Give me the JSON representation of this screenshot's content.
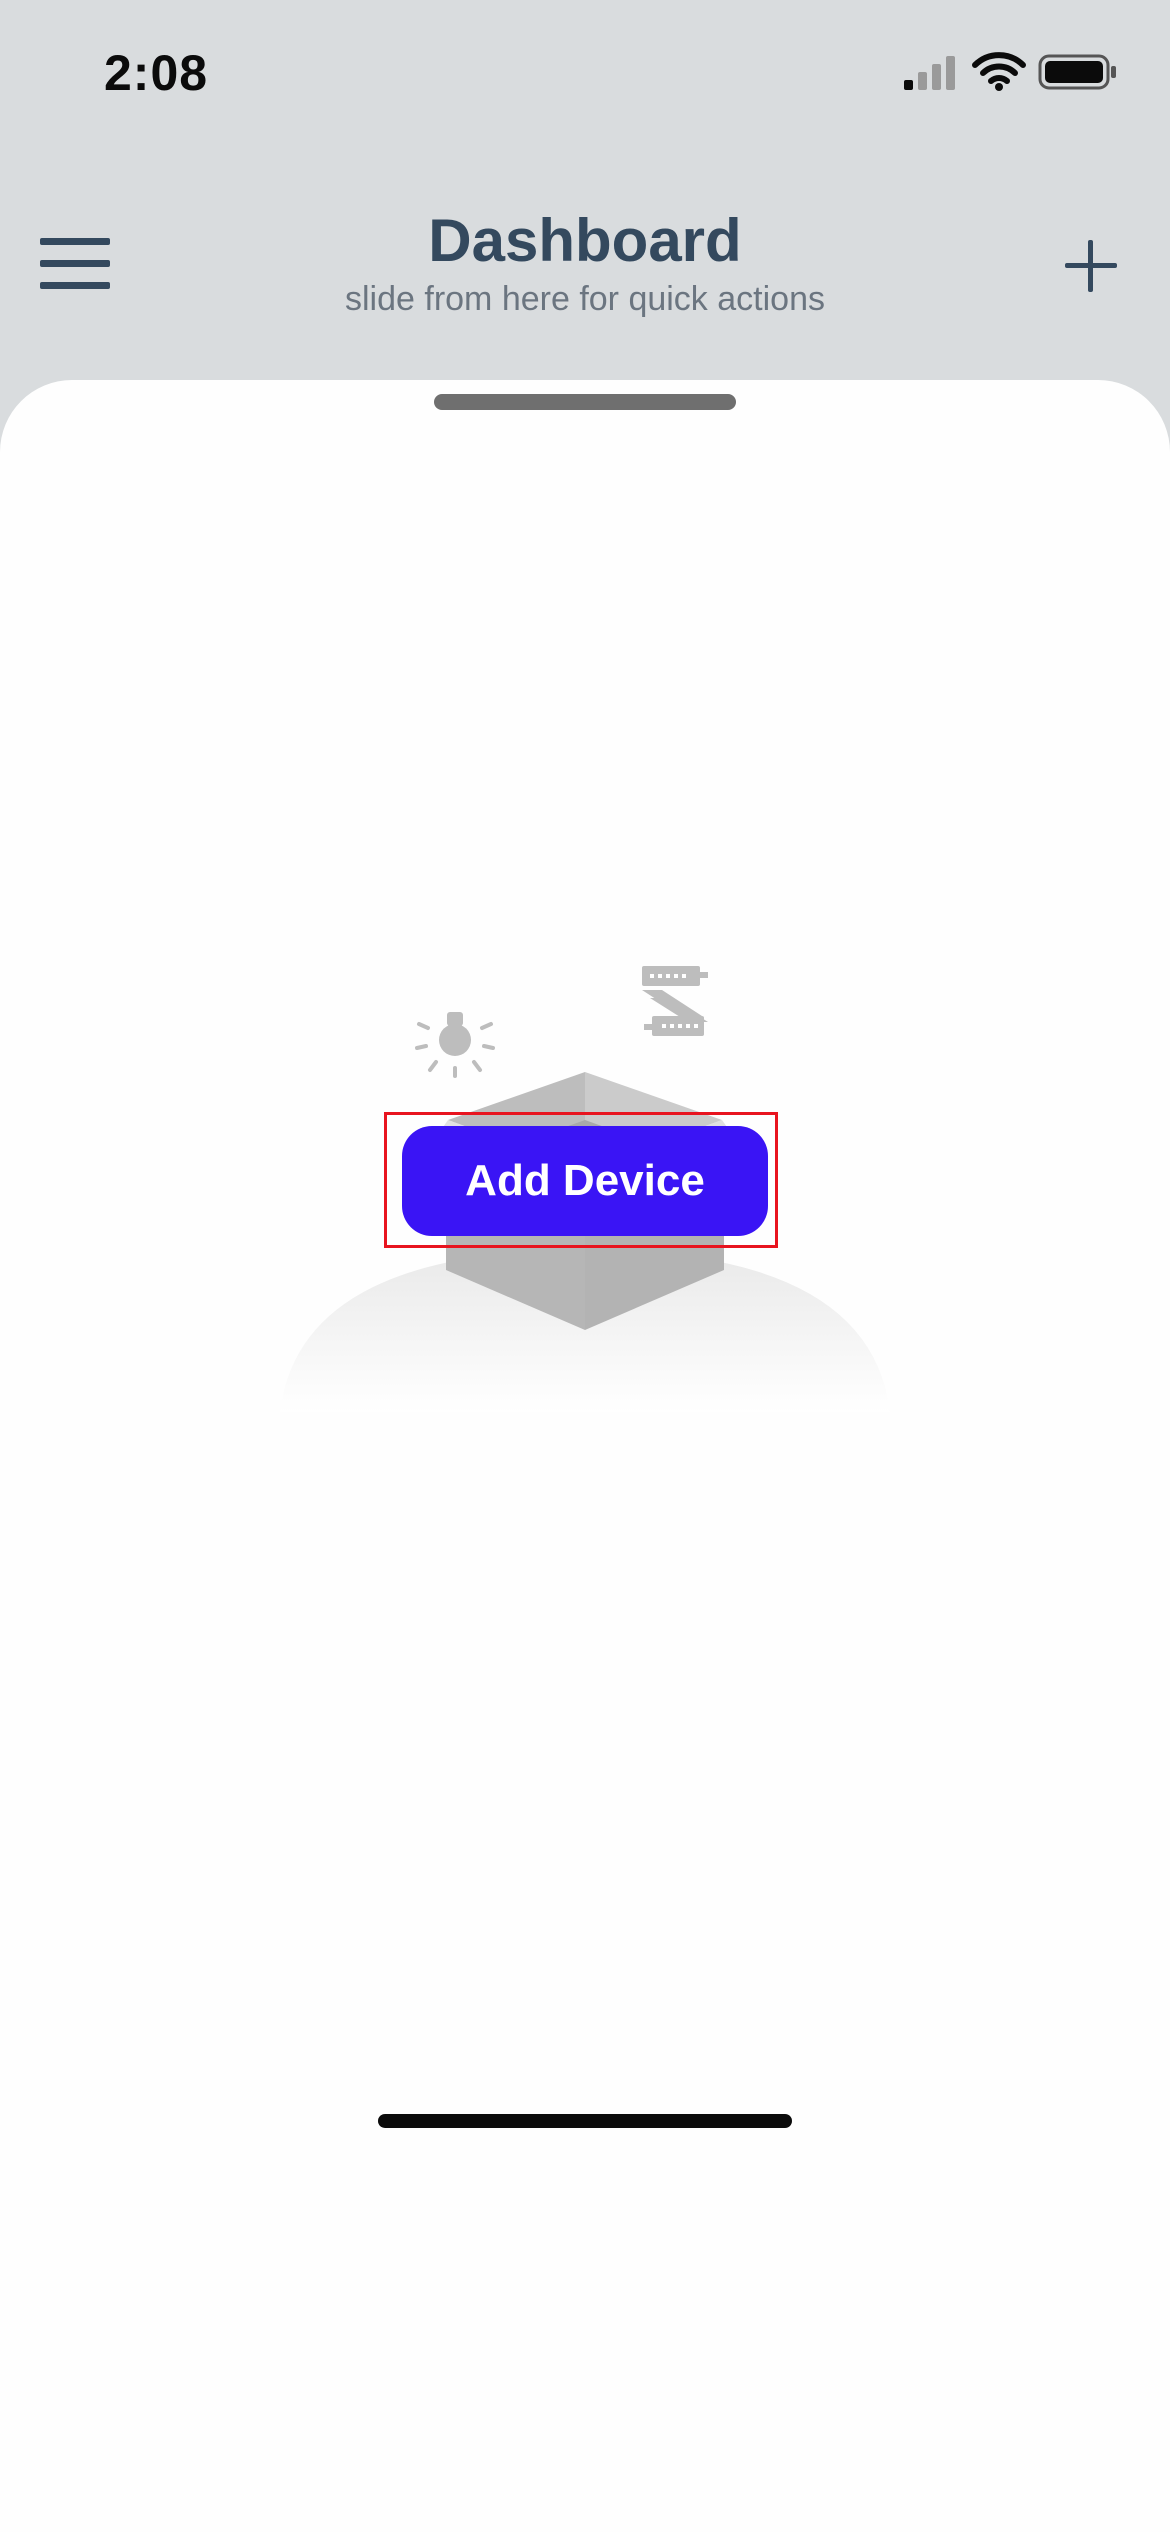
{
  "status_bar": {
    "time": "2:08",
    "icons": [
      "cellular-signal-icon",
      "wifi-icon",
      "battery-icon"
    ]
  },
  "header": {
    "title": "Dashboard",
    "subtitle": "slide from here for quick actions",
    "left_icon": "hamburger-menu-icon",
    "right_icon": "plus-icon"
  },
  "empty_state": {
    "illustration_icons": [
      "open-box-icon",
      "light-bulb-icon",
      "switch-device-icon"
    ],
    "button_label": "Add Device"
  },
  "colors": {
    "accent": "#3a14f5",
    "header_text": "#34495e",
    "subtitle_text": "#6b7580",
    "header_background": "#d9dcde",
    "sheet_background": "#fefefe",
    "highlight_border": "#e8141f"
  }
}
